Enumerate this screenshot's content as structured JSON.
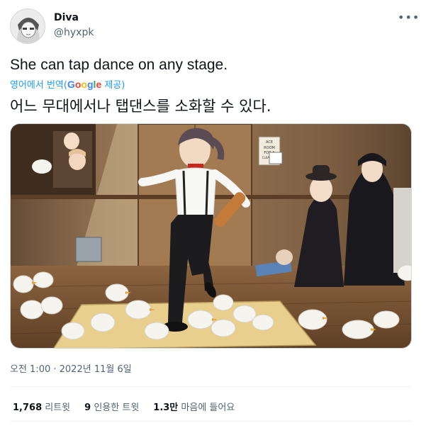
{
  "author": {
    "display_name": "Diva",
    "handle": "@hyxpk"
  },
  "tweet": {
    "text": "She can tap dance on any stage.",
    "translate_prefix": "영어에서 번역(",
    "translate_provider": "Google",
    "translate_suffix": " 제공)",
    "translated_text": "어느 무대에서나 탭댄스를 소화할 수 있다.",
    "timestamp": "오전 1:00 · 2022년 11월 6일"
  },
  "media": {
    "sign_text": [
      "ACE",
      "ROOM",
      "FOR A",
      "CLEANING"
    ]
  },
  "stats": {
    "retweets_count": "1,768",
    "retweets_label": "리트윗",
    "quotes_count": "9",
    "quotes_label": "인용한 트윗",
    "likes_count": "1.3만",
    "likes_label": "마음에 들어요"
  },
  "colors": {
    "link": "#1d9bf0",
    "secondary_text": "#536471",
    "primary_text": "#0f1419",
    "divider": "#eff3f4"
  },
  "icons": {
    "more": "more-horizontal-icon"
  }
}
